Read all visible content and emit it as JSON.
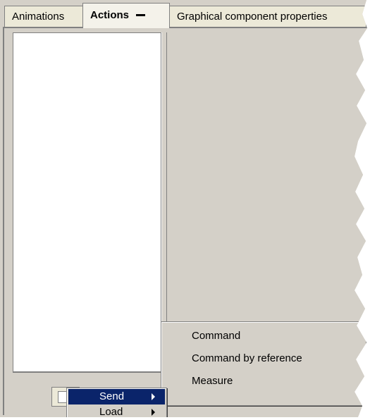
{
  "tabs": [
    {
      "label": "Animations",
      "active": false
    },
    {
      "label": "Actions",
      "active": true
    },
    {
      "label": "Graphical component properties",
      "active": false
    }
  ],
  "context_menu": {
    "items": [
      {
        "label": "Send",
        "selected": true,
        "has_submenu": true
      },
      {
        "label": "Load",
        "selected": false,
        "has_submenu": true
      }
    ]
  },
  "submenu": {
    "items": [
      {
        "label": "Command"
      },
      {
        "label": "Command by reference"
      },
      {
        "label": "Measure"
      }
    ]
  },
  "colors": {
    "face": "#d4d0c8",
    "highlight": "#0a246a",
    "tab_bg": "#ece9d8"
  }
}
